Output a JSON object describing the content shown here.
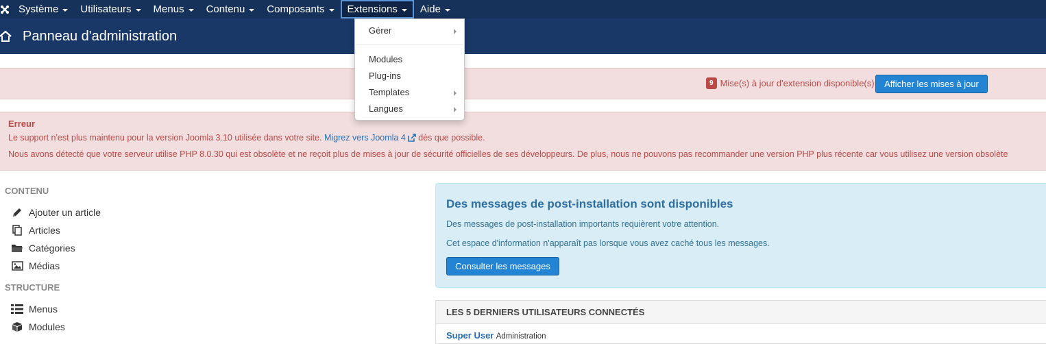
{
  "navbar": {
    "items": [
      {
        "label": "Système"
      },
      {
        "label": "Utilisateurs"
      },
      {
        "label": "Menus"
      },
      {
        "label": "Contenu"
      },
      {
        "label": "Composants"
      },
      {
        "label": "Extensions",
        "active": true
      },
      {
        "label": "Aide"
      }
    ]
  },
  "header": {
    "title": "Panneau d'administration"
  },
  "extensions_menu": {
    "items": [
      {
        "label": "Gérer",
        "submenu": true
      },
      {
        "label": "Modules",
        "submenu": false
      },
      {
        "label": "Plug-ins",
        "submenu": false
      },
      {
        "label": "Templates",
        "submenu": true
      },
      {
        "label": "Langues",
        "submenu": true
      }
    ]
  },
  "updates": {
    "count": "9",
    "text": "Mise(s) à jour d'extension disponible(s)",
    "button": "Afficher les mises à jour"
  },
  "error": {
    "title": "Erreur",
    "line1_before": "Le support n'est plus maintenu pour la version Joomla 3.10 utilisée dans votre site.",
    "line1_link": "Migrez vers Joomla 4",
    "line1_after": "dès que possible.",
    "line2": "Nous avons détecté que votre serveur utilise PHP 8.0.30 qui est obsolète et ne reçoit plus de mises à jour de sécurité officielles de ses développeurs. De plus, nous ne pouvons pas recommander une version PHP plus récente car vous utilisez une version obsolète"
  },
  "sidebar": {
    "content_title": "CONTENU",
    "content_items": [
      {
        "label": "Ajouter un article",
        "icon": "pencil-icon"
      },
      {
        "label": "Articles",
        "icon": "copy-icon"
      },
      {
        "label": "Catégories",
        "icon": "folder-icon"
      },
      {
        "label": "Médias",
        "icon": "image-icon"
      }
    ],
    "structure_title": "STRUCTURE",
    "structure_items": [
      {
        "label": "Menus",
        "icon": "list-icon"
      },
      {
        "label": "Modules",
        "icon": "cube-icon"
      }
    ]
  },
  "post_install": {
    "title": "Des messages de post-installation sont disponibles",
    "p1": "Des messages de post-installation importants requièrent votre attention.",
    "p2": "Cet espace d'information n'apparaît pas lorsque vous avez caché tous les messages.",
    "button": "Consulter les messages"
  },
  "users_panel": {
    "title": "LES 5 DERNIERS UTILISATEURS CONNECTÉS",
    "rows": [
      {
        "name": "Super User",
        "role": "Administration"
      }
    ]
  },
  "colors": {
    "navbar": "#17325a",
    "header": "#1a3867",
    "error_bg": "#f2dede",
    "error_text": "#b94a48",
    "primary_button": "#2384d3",
    "info_bg": "#d9edf7"
  }
}
